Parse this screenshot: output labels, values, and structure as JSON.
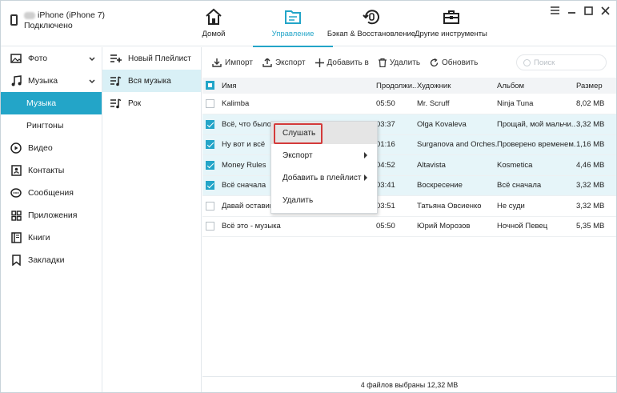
{
  "device": {
    "name": "iPhone (iPhone 7)",
    "status": "Подключено"
  },
  "nav": [
    {
      "label": "Домой",
      "icon": "home-icon",
      "active": false
    },
    {
      "label": "Управление",
      "icon": "folder-icon",
      "active": true
    },
    {
      "label": "Бэкап & Восстановление",
      "icon": "backup-restore-icon",
      "active": false
    },
    {
      "label": "Другие инструменты",
      "icon": "toolbox-icon",
      "active": false
    }
  ],
  "sidebar": {
    "items": [
      {
        "label": "Фото",
        "icon": "photo-icon"
      },
      {
        "label": "Музыка",
        "icon": "music-icon"
      },
      {
        "label": "Музыка",
        "icon": "",
        "sub": true,
        "active": true
      },
      {
        "label": "Рингтоны",
        "icon": "",
        "sub": true
      },
      {
        "label": "Видео",
        "icon": "video-icon"
      },
      {
        "label": "Контакты",
        "icon": "contacts-icon"
      },
      {
        "label": "Сообщения",
        "icon": "messages-icon"
      },
      {
        "label": "Приложения",
        "icon": "apps-icon"
      },
      {
        "label": "Книги",
        "icon": "books-icon"
      },
      {
        "label": "Закладки",
        "icon": "bookmarks-icon"
      }
    ]
  },
  "playlists": {
    "items": [
      {
        "label": "Новый Плейлист",
        "icon": "add-playlist-icon"
      },
      {
        "label": "Вся музыка",
        "icon": "playlist-icon",
        "active": true
      },
      {
        "label": "Рок",
        "icon": "playlist-icon"
      }
    ]
  },
  "toolbar": {
    "import": "Импорт",
    "export": "Экспорт",
    "add_to": "Добавить в",
    "delete": "Удалить",
    "refresh": "Обновить",
    "search_placeholder": "Поиск"
  },
  "table": {
    "columns": [
      "Имя",
      "Продолжи...",
      "Художник",
      "Альбом",
      "Размер"
    ],
    "rows": [
      {
        "checked": false,
        "name": "Kalimba",
        "duration": "05:50",
        "artist": "Mr. Scruff",
        "album": "Ninja Tuna",
        "size": "8,02 MB"
      },
      {
        "checked": true,
        "name": "Всё, что было",
        "duration": "03:37",
        "artist": "Olga Kovaleva",
        "album": "Прощай, мой мальчи...",
        "size": "3,32 MB"
      },
      {
        "checked": true,
        "name": "Ну вот и всё",
        "duration": "01:16",
        "artist": "Surganova and Orches...",
        "album": "Проверено временем...",
        "size": "1,16 MB"
      },
      {
        "checked": true,
        "name": "Money Rules",
        "duration": "04:52",
        "artist": "Altavista",
        "album": "Kosmetica",
        "size": "4,46 MB"
      },
      {
        "checked": true,
        "name": "Всё сначала",
        "duration": "03:41",
        "artist": "Воскресение",
        "album": "Всё сначала",
        "size": "3,32 MB"
      },
      {
        "checked": false,
        "name": "Давай оставим",
        "duration": "03:51",
        "artist": "Татьяна Овсиенко",
        "album": "Не суди",
        "size": "3,32 MB"
      },
      {
        "checked": false,
        "name": "Всё это - музыка",
        "duration": "05:50",
        "artist": "Юрий Морозов",
        "album": "Ночной Певец",
        "size": "5,35 MB"
      }
    ]
  },
  "footer": {
    "status": "4 файлов выбраны 12,32 MB"
  },
  "context_menu": {
    "items": [
      {
        "label": "Слушать",
        "highlighted": true
      },
      {
        "label": "Экспорт",
        "submenu": true
      },
      {
        "label": "Добавить в плейлист",
        "submenu": true
      },
      {
        "label": "Удалить"
      }
    ]
  },
  "colors": {
    "accent": "#23a5c8",
    "selected_row": "#e6f5f9",
    "highlight_border": "#d43a3a"
  }
}
